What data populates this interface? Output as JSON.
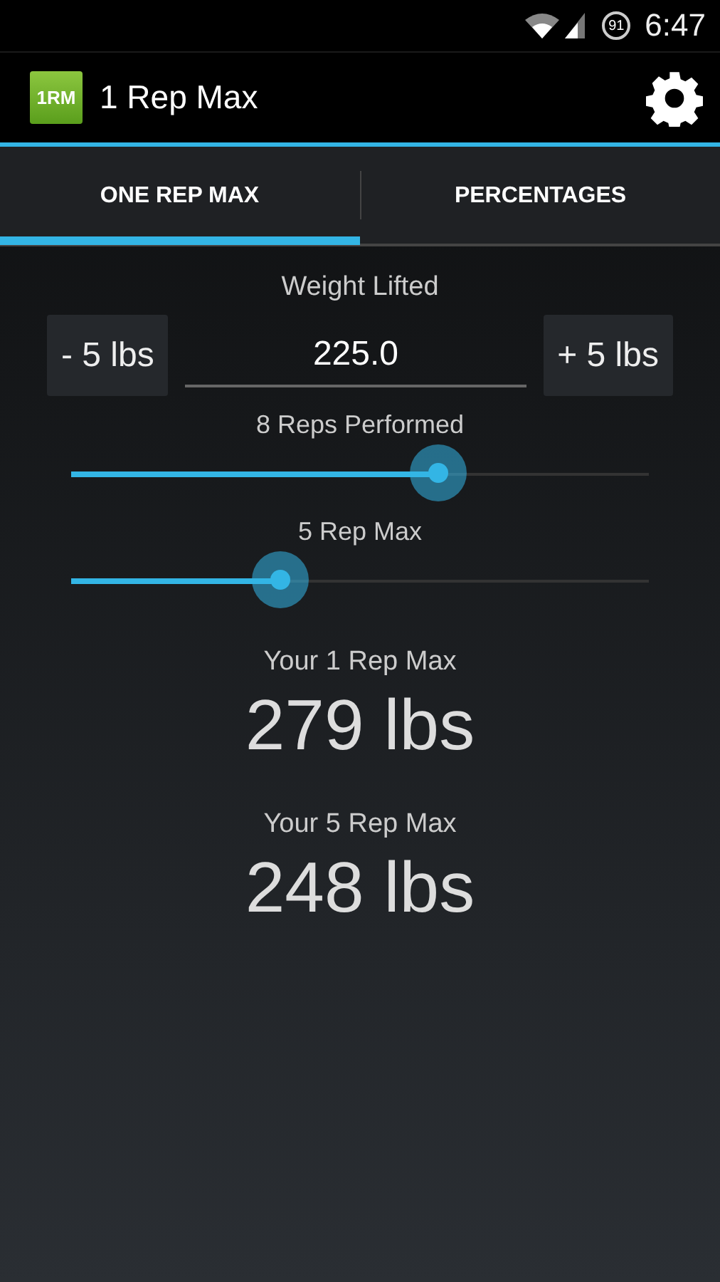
{
  "status_bar": {
    "battery": "91",
    "time": "6:47"
  },
  "app_bar": {
    "logo": "1RM",
    "title": "1 Rep Max"
  },
  "tabs": [
    {
      "label": "ONE REP MAX",
      "selected": true
    },
    {
      "label": "PERCENTAGES",
      "selected": false
    }
  ],
  "weight": {
    "label": "Weight Lifted",
    "decrease": "- 5 lbs",
    "value": "225.0",
    "increase": "+ 5 lbs"
  },
  "sliders": [
    {
      "label": "8 Reps Performed",
      "level": 0.635
    },
    {
      "label": "5 Rep Max",
      "level": 0.362
    }
  ],
  "results": [
    {
      "label": "Your 1 Rep Max",
      "value": "279 lbs"
    },
    {
      "label": "Your 5 Rep Max",
      "value": "248 lbs"
    }
  ]
}
